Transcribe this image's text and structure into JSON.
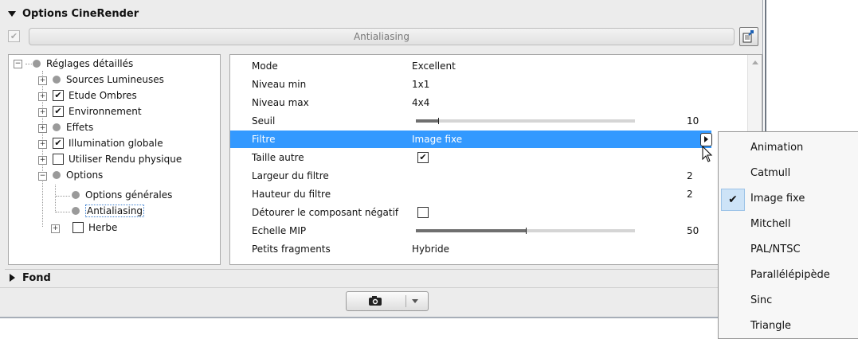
{
  "options_header": "Options CineRender",
  "tab_label": "Antialiasing",
  "tree": {
    "root": "Réglages détaillés",
    "items": [
      {
        "label": "Sources Lumineuses",
        "kind": "dot",
        "checked": false
      },
      {
        "label": "Etude Ombres",
        "kind": "check",
        "checked": true
      },
      {
        "label": "Environnement",
        "kind": "check",
        "checked": true
      },
      {
        "label": "Effets",
        "kind": "dot",
        "checked": false
      },
      {
        "label": "Illumination globale",
        "kind": "check",
        "checked": true
      },
      {
        "label": "Utiliser Rendu physique",
        "kind": "check",
        "checked": false
      },
      {
        "label": "Options",
        "kind": "dot",
        "checked": false
      }
    ],
    "sub_items": [
      "Options générales",
      "Antialiasing"
    ],
    "last_item": "Herbe"
  },
  "grid": {
    "rows": [
      {
        "name": "Mode",
        "value": "Excellent"
      },
      {
        "name": "Niveau min",
        "value": "1x1"
      },
      {
        "name": "Niveau max",
        "value": "4x4"
      },
      {
        "name": "Seuil",
        "value": "10",
        "slider_fraction": 0.1
      },
      {
        "name": "Filtre",
        "value": "Image fixe"
      },
      {
        "name": "Taille autre",
        "value": "checked"
      },
      {
        "name": "Largeur du filtre",
        "value": "2"
      },
      {
        "name": "Hauteur du filtre",
        "value": "2"
      },
      {
        "name": "Détourer le composant négatif",
        "value": "unchecked"
      },
      {
        "name": "Echelle MIP",
        "value": "50",
        "slider_fraction": 0.5
      },
      {
        "name": "Petits fragments",
        "value": "Hybride"
      }
    ]
  },
  "fond_header": "Fond",
  "filter_menu": {
    "items": [
      "Animation",
      "Catmull",
      "Image fixe",
      "Mitchell",
      "PAL/NTSC",
      "Parallélépipède",
      "Sinc",
      "Triangle"
    ],
    "selected": "Image fixe",
    "check_glyph": "✔"
  },
  "colors": {
    "selection": "#3399ff",
    "menu_check_bg": "#cde3f7"
  },
  "icons": {
    "checkmark": "✔",
    "collapse": "−",
    "expand": "+"
  }
}
